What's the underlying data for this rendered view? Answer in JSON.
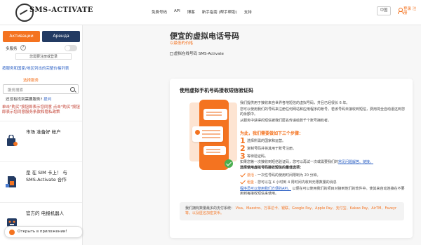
{
  "header": {
    "logo_text": "SMS-ACTIVATE",
    "nav": [
      "免费号码",
      "API",
      "博客",
      "新手指南 (帮手帮助)",
      "支持"
    ],
    "lang": "中国",
    "login": "登录 注册"
  },
  "sidebar": {
    "tab_activation": "Активации",
    "tab_rent": "Аренда",
    "multi_service": "多服务",
    "help": "?",
    "warn_text": "您需要注册或登录",
    "country_link": "按服务和国家/地区列出的完整价格列表",
    "select_service": "选择服务",
    "search_placeholder": "服务搜索",
    "question": "还没有找到需要服务?",
    "question_more": "提问",
    "notice": "单击\"购买\"按钮即表示您同意 点击\"购买\"按钮即表示您同意服务条款和隐私政策",
    "cards": [
      {
        "title": "市场 准备好 帐户"
      },
      {
        "title": "是 在 SIM 卡上！ 与 SMS-Activate 合作"
      },
      {
        "title": "官方的 电报机器人"
      }
    ],
    "open_app": "Открыть в приложении!"
  },
  "main": {
    "title": "便宜的虚拟电话号码",
    "subtitle": "以最低的价格",
    "image_alt": "虚拟在线号码 SMS-Activate",
    "panel": {
      "title": "使用虚拟手机号码接收短信验证码",
      "p1": "我们提供用于接收来自世界各地短信的虚拟号码，并且已经很长 6 年。",
      "p2": "您可以使用我们的号码来注册任何网站和应用程序的帐号。若该号码未接收到短信，费用将全自动退还到您的余额中。",
      "p3": "从服务中获得的短信被我们匿名传递给数千个账号拥有者。",
      "lead": "为此，我们需要做如下三个步骤：",
      "steps": [
        "选择所需的国家和运营。",
        "复制号码并将其用于账号注册。",
        "等待验证码。"
      ],
      "p4": "如果您第一次接收到短信验证码，您可以再试一次或需要我们的",
      "p4_link": "常见问题解答、链接。",
      "options_title": "选择使用虚拟号码接收短信的最佳选项：",
      "options": [
        {
          "tag": "激活",
          "text": " - 一次性号码的使用时间限制为 20 分钟。"
        },
        {
          "tag": "租金",
          "text": " - 您可以在 4 小时到 4 周时间内收到无限数量的消息"
        }
      ],
      "p5_link": "程序员可以使用我们方便的API。",
      "p5": " 以便在可以使用我们的项目对接到他们的软件中。使其来自动连接在不要用到每接收短信来使用。",
      "pay_intro": "我们拥有数量最多的支付系统：",
      "pay_methods": "Visa、Maestro、万事达卡、银联、Google Pay、Apple Pay、支付宝、Kakao Pay、AirTM、Faveyr等，以及匿名加密货币。"
    }
  },
  "colors": {
    "accent": "#f47320",
    "navy": "#233b63",
    "link": "#2a5fc4",
    "notice": "#c0392b"
  }
}
